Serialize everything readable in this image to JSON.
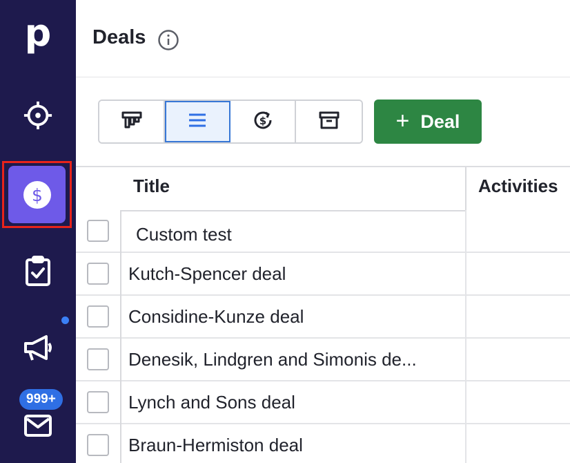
{
  "sidebar": {
    "logo": "p",
    "items": [
      {
        "name": "leads",
        "icon": "target-icon"
      },
      {
        "name": "deals",
        "icon": "dollar-icon",
        "active": true
      },
      {
        "name": "activities",
        "icon": "clipboard-check-icon"
      },
      {
        "name": "campaigns",
        "icon": "megaphone-icon",
        "has_notification": true
      },
      {
        "name": "mail",
        "icon": "envelope-icon",
        "badge": "999+"
      }
    ],
    "mail_badge": "999+"
  },
  "header": {
    "title": "Deals",
    "info_icon": "info-icon"
  },
  "toolbar": {
    "views": [
      {
        "name": "pipeline",
        "icon": "pipeline-icon",
        "active": false
      },
      {
        "name": "list",
        "icon": "list-icon",
        "active": true
      },
      {
        "name": "forecast",
        "icon": "forecast-icon",
        "active": false
      },
      {
        "name": "archive",
        "icon": "archive-icon",
        "active": false
      }
    ],
    "add_deal_label": "Deal",
    "add_deal_icon": "plus-icon"
  },
  "table": {
    "columns": [
      "Title",
      "Activities"
    ],
    "rows": [
      {
        "title": "Custom test"
      },
      {
        "title": "Kutch-Spencer deal"
      },
      {
        "title": "Considine-Kunze deal"
      },
      {
        "title": "Denesik, Lindgren and Simonis de..."
      },
      {
        "title": "Lynch and Sons deal"
      },
      {
        "title": "Braun-Hermiston deal"
      }
    ]
  },
  "colors": {
    "sidebar_bg": "#1e1a4d",
    "active_tile": "#6e5ae8",
    "primary_green": "#2d8643",
    "badge_blue": "#2f6fe4",
    "highlight_red": "#e8231b"
  }
}
